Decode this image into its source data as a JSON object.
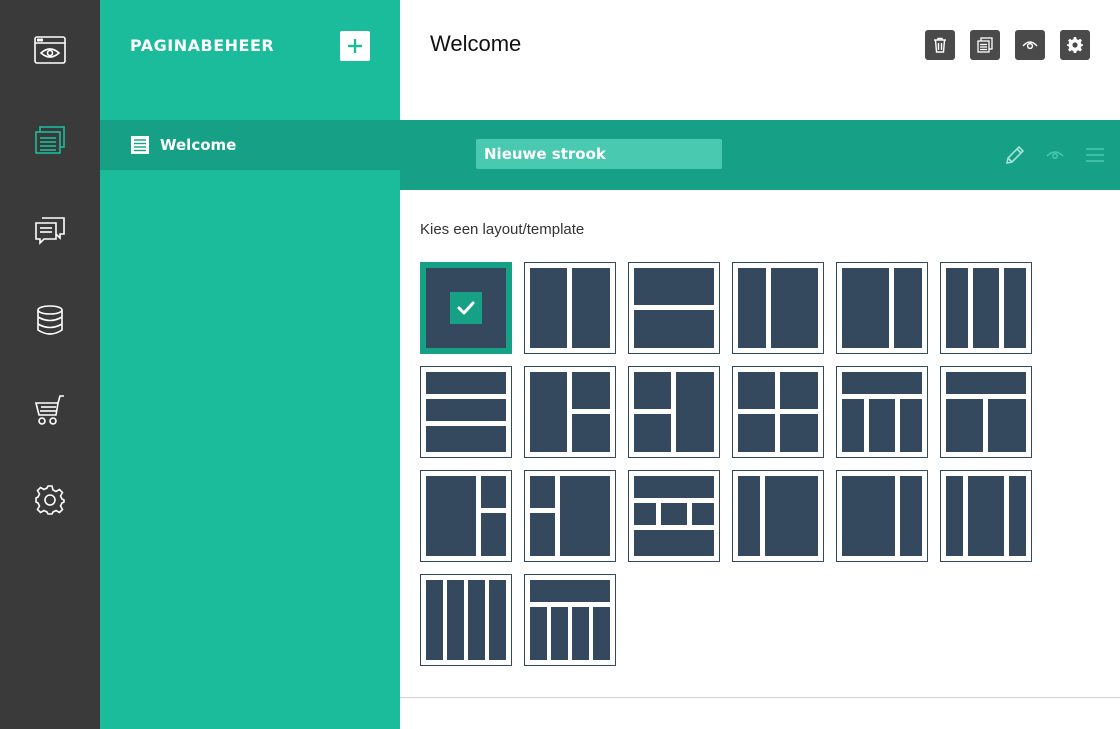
{
  "sidebar": {
    "items": [
      {
        "name": "rail-preview",
        "icon": "browser-eye-icon"
      },
      {
        "name": "rail-pages",
        "icon": "pages-icon",
        "active": true
      },
      {
        "name": "rail-comments",
        "icon": "chat-icon"
      },
      {
        "name": "rail-database",
        "icon": "database-icon"
      },
      {
        "name": "rail-shop",
        "icon": "cart-icon"
      },
      {
        "name": "rail-settings",
        "icon": "gear-icon"
      }
    ]
  },
  "panel": {
    "title": "PAGINABEHEER",
    "add_icon": "plus-icon",
    "pages": [
      {
        "label": "Welcome",
        "icon": "page-icon"
      }
    ]
  },
  "main": {
    "title": "Welcome",
    "toolbar": [
      "trash-icon",
      "copy-icon",
      "eye-icon",
      "gear-icon"
    ],
    "strip": {
      "value": "Nieuwe strook",
      "icons": [
        "pencil-icon",
        "eye-icon",
        "menu-icon"
      ]
    },
    "layout_label": "Kies een layout/template",
    "selected_template": 0
  },
  "colors": {
    "rail": "#3a3a3a",
    "panel": "#1abc9c",
    "panel_dark": "#16a085",
    "tile_fill": "#34495e"
  }
}
